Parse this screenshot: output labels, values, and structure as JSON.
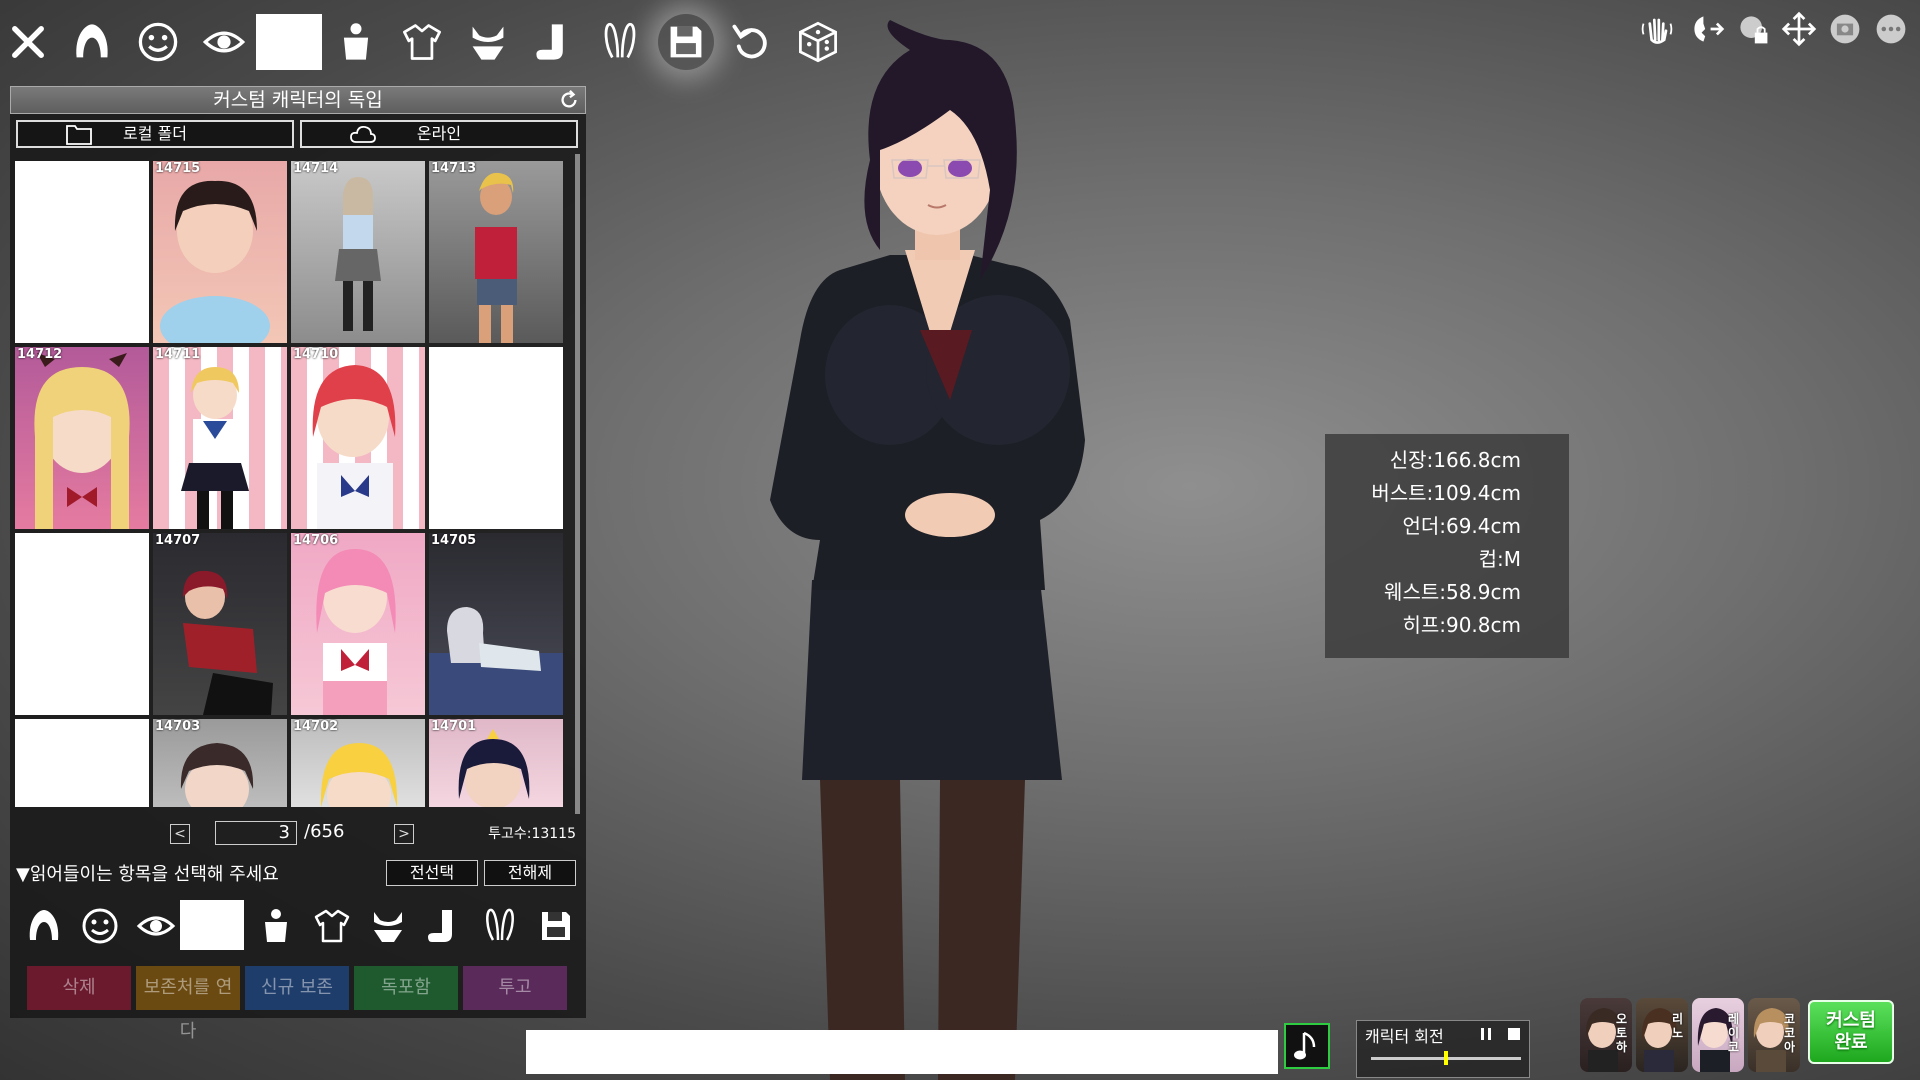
{
  "toolbar": {
    "items": [
      "close-icon",
      "hair-icon",
      "face-icon",
      "eye-icon",
      "blank-slot",
      "torso-icon",
      "clothes-icon",
      "underwear-icon",
      "sock-icon",
      "bunny-ears-icon",
      "save-icon",
      "undo-icon",
      "dice-icon"
    ]
  },
  "top_right_tools": [
    "hand-wave-icon",
    "look-follow-icon",
    "camera-lock-icon",
    "move-icon",
    "screenshot-icon",
    "more-icon"
  ],
  "panel": {
    "title": "커스텀 캐릭터의 독입",
    "local_folder": "로컬 폴더",
    "online": "온라인",
    "cards": [
      {
        "num": "",
        "blank": true
      },
      {
        "num": "14715"
      },
      {
        "num": "14714"
      },
      {
        "num": "14713"
      },
      {
        "num": "14712"
      },
      {
        "num": "14711"
      },
      {
        "num": "14710"
      },
      {
        "num": "",
        "blank": true
      },
      {
        "num": "",
        "blank": true
      },
      {
        "num": "14707"
      },
      {
        "num": "14706"
      },
      {
        "num": "14705"
      },
      {
        "num": "",
        "blank": true
      },
      {
        "num": "14703"
      },
      {
        "num": "14702"
      },
      {
        "num": "14701"
      }
    ],
    "pager": {
      "prev": "<",
      "next": ">",
      "current": "3",
      "total": "/656",
      "post_count": "투고수:13115"
    },
    "select_label": "▼읽어들이는 항목을 선택해 주세요",
    "select_all": "전선택",
    "deselect_all": "전해제",
    "actions": {
      "delete": "삭제",
      "open_folder": "보존처를 연다",
      "new_save": "신규 보존",
      "bookmark": "독포함",
      "post": "투고"
    }
  },
  "stats": {
    "height": "신장:166.8cm",
    "bust": "버스트:109.4cm",
    "under": "언더:69.4cm",
    "cup": "컵:M",
    "waist": "웨스트:58.9cm",
    "hip": "히프:90.8cm"
  },
  "rotation": {
    "label": "캐릭터 회전",
    "value": 0.5
  },
  "characters": [
    {
      "label": "오토하"
    },
    {
      "label": "리노"
    },
    {
      "label": "레이코"
    },
    {
      "label": "코코아"
    }
  ],
  "done_button": "커스텀\n완료",
  "colors": {
    "delete": "#6b1a2e",
    "open_folder": "#6b4a12",
    "new_save": "#1f3d6b",
    "bookmark": "#1e5a2e",
    "post": "#5a2a5a",
    "accent_green": "#2ecc40"
  }
}
